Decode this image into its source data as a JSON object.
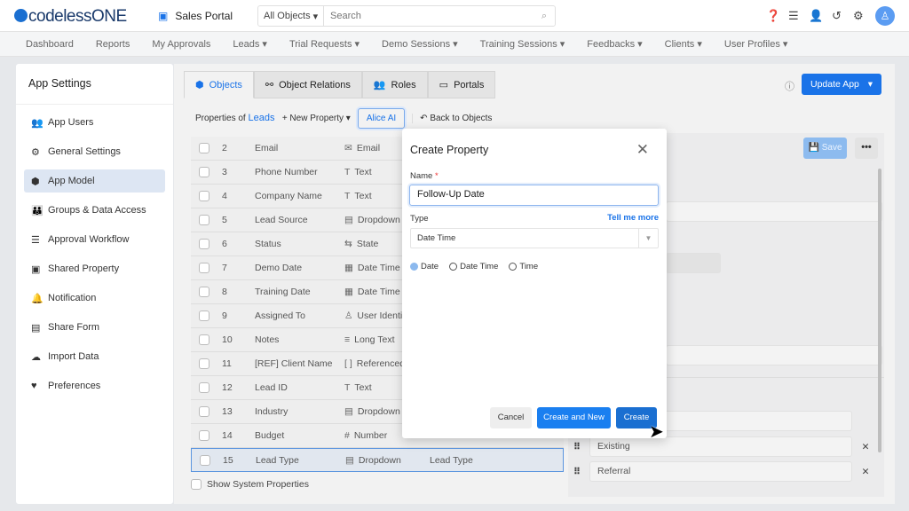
{
  "header": {
    "logo": "codelessONE",
    "portal": "Sales Portal",
    "search_scope": "All Objects",
    "search_placeholder": "Search"
  },
  "nav": [
    "Dashboard",
    "Reports",
    "My Approvals",
    "Leads ▾",
    "Trial Requests ▾",
    "Demo Sessions ▾",
    "Training Sessions ▾",
    "Feedbacks ▾",
    "Clients ▾",
    "User Profiles ▾"
  ],
  "sidebar": {
    "title": "App Settings",
    "items": [
      {
        "label": "App Users",
        "icon": "👥"
      },
      {
        "label": "General Settings",
        "icon": "⚙"
      },
      {
        "label": "App Model",
        "icon": "⬢"
      },
      {
        "label": "Groups & Data Access",
        "icon": "👪"
      },
      {
        "label": "Approval Workflow",
        "icon": "☰"
      },
      {
        "label": "Shared Property",
        "icon": "▣"
      },
      {
        "label": "Notification",
        "icon": "🔔"
      },
      {
        "label": "Share Form",
        "icon": "▤"
      },
      {
        "label": "Import Data",
        "icon": "☁"
      },
      {
        "label": "Preferences",
        "icon": "♥"
      }
    ],
    "active": "App Model"
  },
  "tabs": [
    {
      "label": "Objects",
      "icon": "⬢"
    },
    {
      "label": "Object Relations",
      "icon": "⚯"
    },
    {
      "label": "Roles",
      "icon": "👥"
    },
    {
      "label": "Portals",
      "icon": "▭"
    }
  ],
  "update_app": "Update App",
  "toolbar": {
    "properties_of": "Properties of",
    "object": "Leads",
    "new_property": "+ New Property ▾",
    "alice": "Alice AI",
    "back": "↶ Back to Objects"
  },
  "table": {
    "rows": [
      {
        "n": "2",
        "name": "Email",
        "icon": "✉",
        "type": "Email"
      },
      {
        "n": "3",
        "name": "Phone Number",
        "icon": "T",
        "type": "Text"
      },
      {
        "n": "4",
        "name": "Company Name",
        "icon": "T",
        "type": "Text"
      },
      {
        "n": "5",
        "name": "Lead Source",
        "icon": "▤",
        "type": "Dropdown"
      },
      {
        "n": "6",
        "name": "Status",
        "icon": "⇆",
        "type": "State"
      },
      {
        "n": "7",
        "name": "Demo Date",
        "icon": "▦",
        "type": "Date Time"
      },
      {
        "n": "8",
        "name": "Training Date",
        "icon": "▦",
        "type": "Date Time"
      },
      {
        "n": "9",
        "name": "Assigned To",
        "icon": "♙",
        "type": "User Identi"
      },
      {
        "n": "10",
        "name": "Notes",
        "icon": "≡",
        "type": "Long Text"
      },
      {
        "n": "11",
        "name": "[REF] Client Name",
        "icon": "[ ]",
        "type": "Referenced"
      },
      {
        "n": "12",
        "name": "Lead ID",
        "icon": "T",
        "type": "Text"
      },
      {
        "n": "13",
        "name": "Industry",
        "icon": "▤",
        "type": "Dropdown"
      },
      {
        "n": "14",
        "name": "Budget",
        "icon": "#",
        "type": "Number"
      },
      {
        "n": "15",
        "name": "Lead Type",
        "icon": "▤",
        "type": "Dropdown",
        "extra": "Lead Type"
      }
    ],
    "show_system": "Show System Properties"
  },
  "right_panel": {
    "save": "Save",
    "more": "•••",
    "options": [
      "Existing",
      "Referral"
    ]
  },
  "modal": {
    "title": "Create Property",
    "name_label": "Name",
    "name_value": "Follow-Up Date",
    "type_label": "Type",
    "tell_more": "Tell me more",
    "type_value": "Date Time",
    "radios": [
      {
        "label": "Date",
        "checked": true
      },
      {
        "label": "Date Time",
        "checked": false
      },
      {
        "label": "Time",
        "checked": false
      }
    ],
    "cancel": "Cancel",
    "create_new": "Create and New",
    "create": "Create"
  }
}
